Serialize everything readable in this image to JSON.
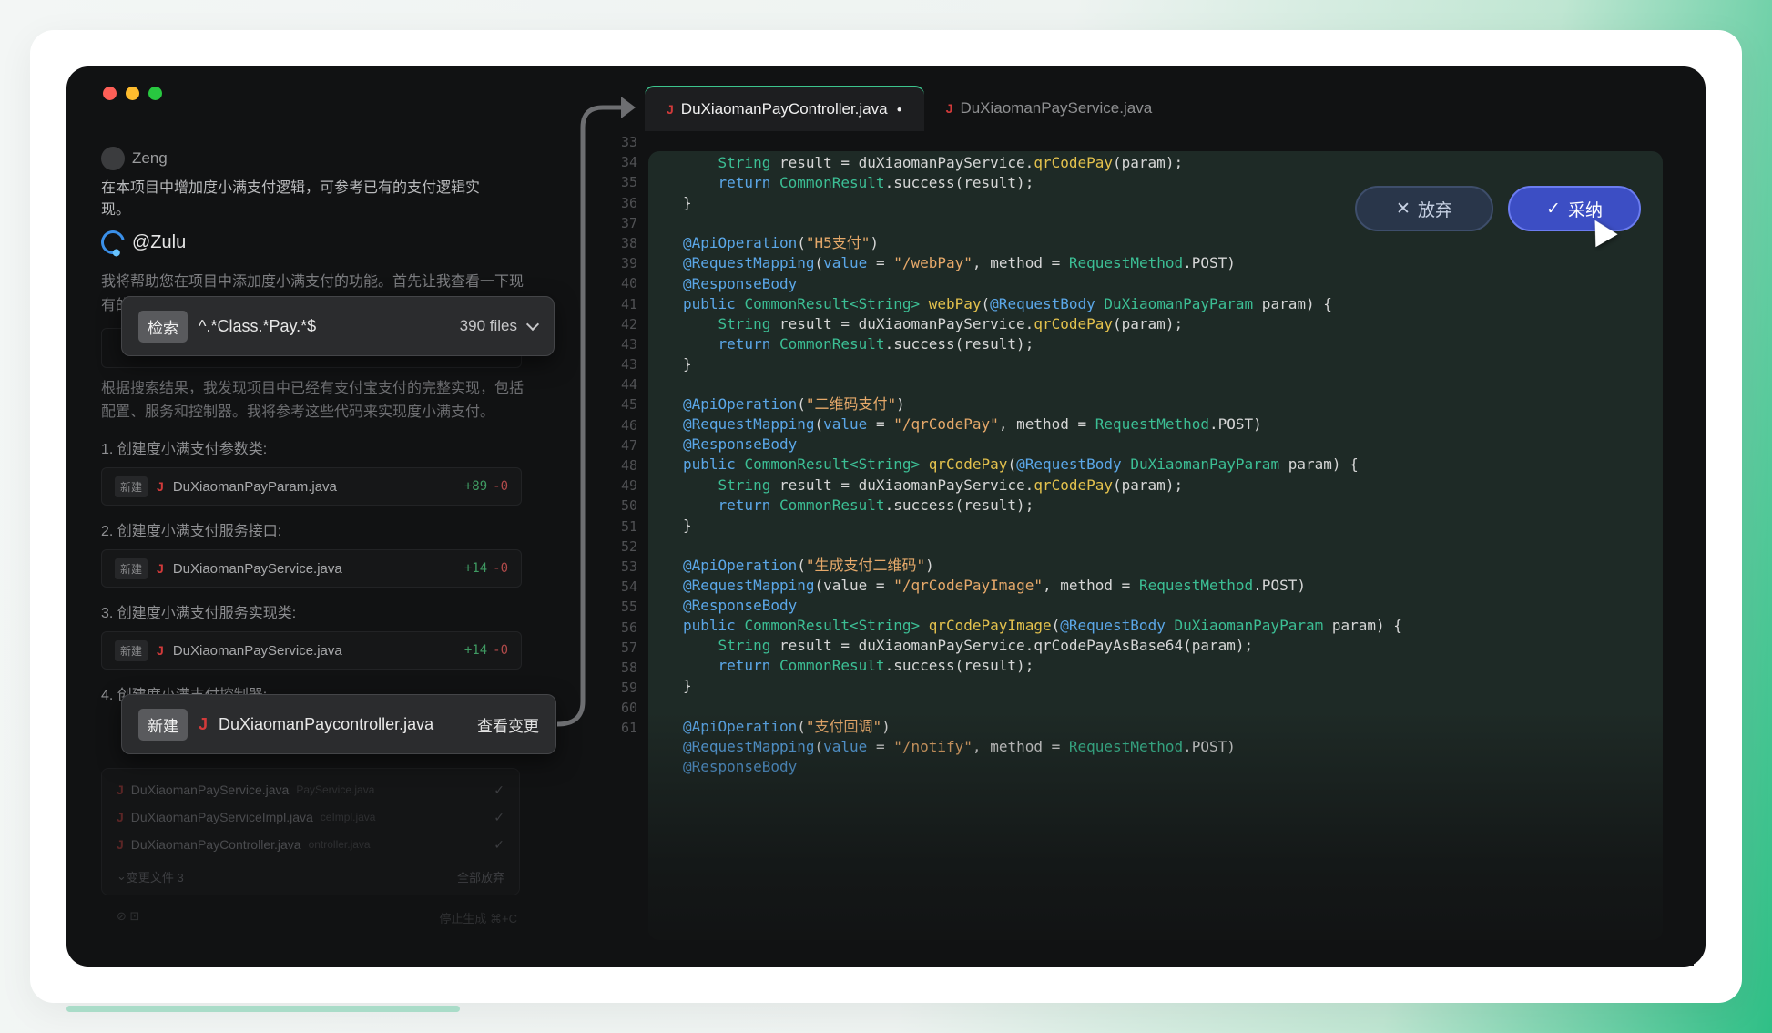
{
  "window": {
    "traffic_lights": [
      "close",
      "minimize",
      "zoom"
    ]
  },
  "chat": {
    "user_name": "Zeng",
    "user_message": "在本项目中增加度小满支付逻辑，可参考已有的支付逻辑实现。",
    "bot_name": "@Zulu",
    "bot_message": "我将帮助您在项目中添加度小满支付的功能。首先让我查看一下现有的支付相关代码，以便参考其实现逻辑。",
    "search_result_message": "根据搜索结果，我发现项目中已经有支付宝支付的完整实现，包括配置、服务和控制器。我将参考这些代码来实现度小满支付。",
    "steps": [
      {
        "label": "1. 创建度小满支付参数类:",
        "tag": "新建",
        "file": "DuXiaomanPayParam.java",
        "plus": "+89",
        "minus": "-0"
      },
      {
        "label": "2. 创建度小满支付服务接口:",
        "tag": "新建",
        "file": "DuXiaomanPayService.java",
        "plus": "+14",
        "minus": "-0"
      },
      {
        "label": "3. 创建度小满支付服务实现类:",
        "tag": "新建",
        "file": "DuXiaomanPayService.java",
        "plus": "+14",
        "minus": "-0"
      },
      {
        "label": "4. 创建度小满支付控制器:"
      }
    ],
    "search_pill": {
      "tag": "检索",
      "query": "^.*Class.*Pay.*$",
      "count": "390 files"
    },
    "newfile_pill": {
      "tag": "新建",
      "file": "DuXiaomanPaycontroller.java",
      "action": "查看变更"
    },
    "changes": [
      {
        "file": "DuXiaomanPayService.java",
        "ghost": "PayService.java"
      },
      {
        "file": "DuXiaomanPayServiceImpl.java",
        "ghost": "ceImpl.java"
      },
      {
        "file": "DuXiaomanPayController.java",
        "ghost": "ontroller.java"
      }
    ],
    "changes_footer": {
      "count_label": "变更文件 3",
      "discard_all": "全部放弃"
    },
    "input_hint": "停止生成 ⌘+C"
  },
  "editor": {
    "tabs": [
      {
        "label": "DuXiaomanPayController.java",
        "modified": "●",
        "active": true
      },
      {
        "label": "DuXiaomanPayService.java",
        "active": false
      }
    ],
    "line_numbers": [
      "33",
      "34",
      "35",
      "36",
      "37",
      "38",
      "39",
      "40",
      "41",
      "42",
      "43",
      "43",
      "44",
      "45",
      "46",
      "47",
      "48",
      "49",
      "50",
      "51",
      "52",
      "53",
      "54",
      "55",
      "56",
      "57",
      "58",
      "59",
      "60",
      "61"
    ],
    "actions": {
      "discard": "放弃",
      "adopt": "采纳"
    }
  },
  "colors": {
    "accent_green": "#3cc48d",
    "adopt_blue": "#3c4ec4",
    "editor_bg": "#1e2a26"
  }
}
